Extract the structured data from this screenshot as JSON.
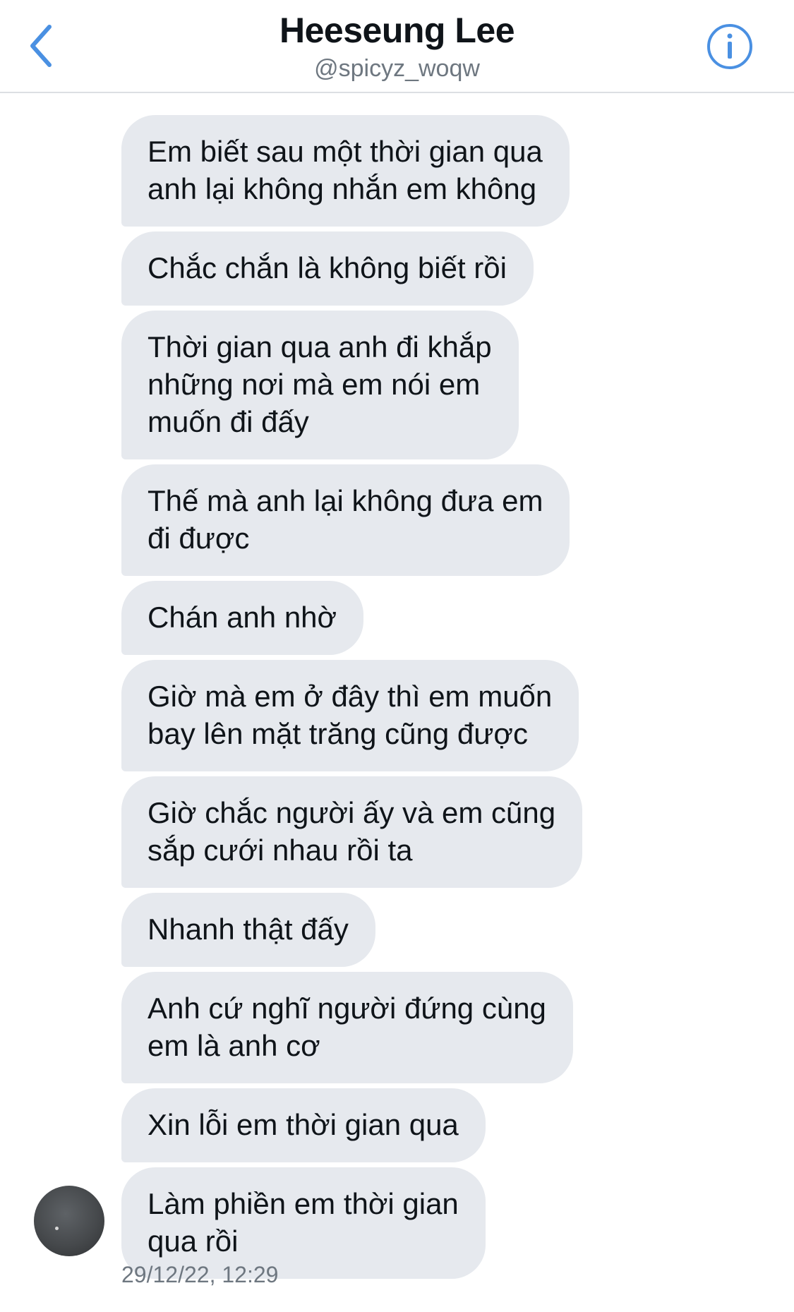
{
  "header": {
    "name": "Heeseung Lee",
    "handle": "@spicyz_woqw",
    "back_icon": "chevron-left-icon",
    "info_icon": "info-icon",
    "accent_color": "#4a90e2"
  },
  "messages": [
    {
      "lines": [
        "Em biết sau một thời gian qua",
        "anh lại không nhắn em không"
      ]
    },
    {
      "lines": [
        "Chắc chắn là không biết rồi"
      ]
    },
    {
      "lines": [
        "Thời gian qua anh đi khắp",
        "những nơi mà em nói em",
        "muốn đi đấy"
      ]
    },
    {
      "lines": [
        "Thế mà anh lại không đưa em",
        "đi được"
      ]
    },
    {
      "lines": [
        "Chán anh nhờ"
      ]
    },
    {
      "lines": [
        "Giờ mà em ở đây thì em muốn",
        "bay lên mặt trăng cũng được"
      ]
    },
    {
      "lines": [
        "Giờ chắc người ấy và em cũng",
        "sắp cưới nhau rồi ta"
      ]
    },
    {
      "lines": [
        "Nhanh thật đấy"
      ]
    },
    {
      "lines": [
        "Anh cứ nghĩ người đứng cùng",
        "em là anh cơ"
      ]
    },
    {
      "lines": [
        "Xin lỗi em thời gian qua"
      ]
    },
    {
      "lines": [
        "Làm phiền em thời gian",
        "qua rồi"
      ]
    }
  ],
  "timestamp": "29/12/22, 12:29",
  "bubble_color": "#e6e9ee"
}
